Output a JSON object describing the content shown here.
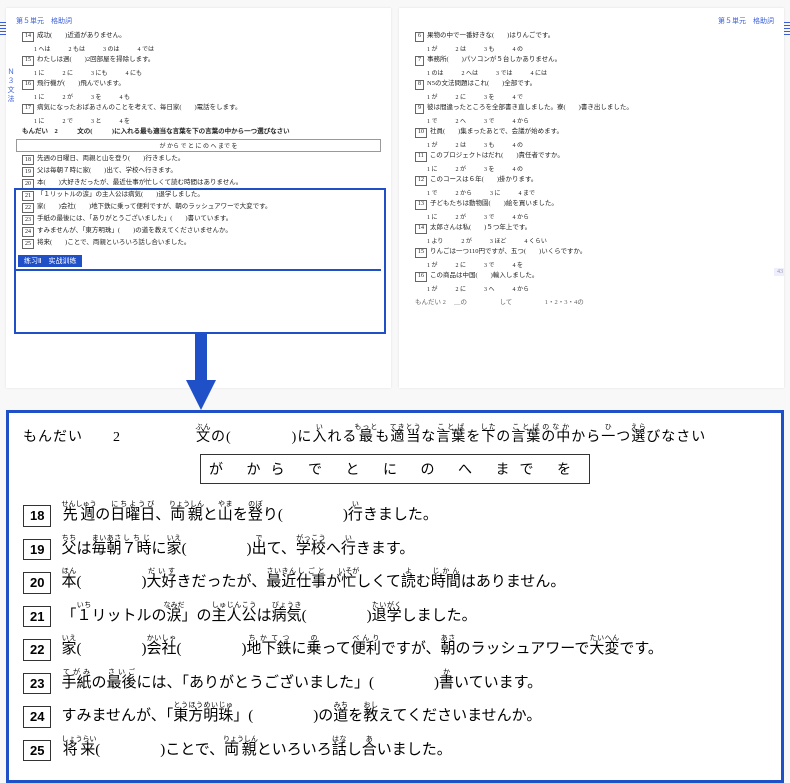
{
  "header": {
    "unit": "第５単元　格助詞",
    "sidelabel": "Ｎ３文法"
  },
  "leftPage": {
    "items": [
      {
        "n": "14",
        "text": "成功(　　)近道がありません。",
        "choices": [
          "1 へは",
          "2 もは",
          "3 のは",
          "4 では"
        ]
      },
      {
        "n": "15",
        "text": "わたしは週(　　)2回部屋を掃除します。",
        "choices": [
          "1 に",
          "2 に",
          "3 にも",
          "4 にも"
        ]
      },
      {
        "n": "16",
        "text": "飛行機が(　　)飛んでいます。",
        "choices": [
          "1 に",
          "2 が",
          "3 を",
          "4 も"
        ]
      },
      {
        "n": "17",
        "text": "病気になったおばあさんのことを考えて、毎日家(　　)電話をします。",
        "choices": [
          "1 に",
          "2 で",
          "3 と",
          "4 を"
        ]
      }
    ],
    "section2": {
      "head": "もんだい　2　　　文の(　　　)に入れる最も適当な言葉を下の言葉の中から一つ選びなさい",
      "options": "が から で と に の へ まで を",
      "items": [
        {
          "n": "18",
          "text": "先週の日曜日、両親と山を登り(　　)行きました。"
        },
        {
          "n": "19",
          "text": "父は毎朝７時に家(　　)出て、学校へ行きます。"
        },
        {
          "n": "20",
          "text": "本(　　)大好きだったが、最近仕事が忙しくて読む時間はありません。"
        },
        {
          "n": "21",
          "text": "「１リットルの涙」の主人公は病気(　　)退学しました。"
        },
        {
          "n": "22",
          "text": "家(　　)会社(　　)地下鉄に乗って便利ですが、朝のラッシュアワーで大変です。"
        },
        {
          "n": "23",
          "text": "手紙の最後には、「ありがとうございました」(　　)書いています。"
        },
        {
          "n": "24",
          "text": "すみませんが、「東方明珠」(　　)の道を教えてくださいませんか。"
        },
        {
          "n": "25",
          "text": "将来(　　)ことで、両親といろいろ話し合いました。"
        }
      ]
    },
    "practice": "练习Ⅱ　实战训练"
  },
  "rightPage": {
    "items": [
      {
        "n": "6",
        "text": "果物の中で一番好きな(　　)はりんごです。",
        "choices": [
          "1 が",
          "2 は",
          "3 も",
          "4 の"
        ]
      },
      {
        "n": "7",
        "text": "事務所(　　)パソコンが５台しかありません。",
        "choices": [
          "1 のは",
          "2 へは",
          "3 では",
          "4 には"
        ]
      },
      {
        "n": "8",
        "text": "N5の文法問題はこれ(　　)全部です。",
        "choices": [
          "1 が",
          "2 に",
          "3 を",
          "4 で"
        ]
      },
      {
        "n": "9",
        "text": "彼は間違ったところを全部書き直しました。寮(　　)書き出しました。",
        "choices": [
          "1 で",
          "2 へ",
          "3 で",
          "4 から"
        ]
      },
      {
        "n": "10",
        "text": "社員(　　)集まったあとで、会議が始めます。",
        "choices": [
          "1 が",
          "2 は",
          "3 も",
          "4 の"
        ]
      },
      {
        "n": "11",
        "text": "このプロジェクトはだれ(　　)責任者ですか。",
        "choices": [
          "1 に",
          "2 が",
          "3 を",
          "4 の"
        ]
      },
      {
        "n": "12",
        "text": "このコースは６年(　　)掛かります。",
        "choices": [
          "1 で",
          "2 から",
          "3 に",
          "4 まで"
        ]
      },
      {
        "n": "13",
        "text": "子どもたちは動物園(　　)絵を買いました。",
        "choices": [
          "1 に",
          "2 が",
          "3 で",
          "4 から"
        ]
      },
      {
        "n": "14",
        "text": "太郎さんは私(　　)５つ年上です。",
        "choices": [
          "1 より",
          "2 が",
          "3 ほど",
          "4 くらい"
        ]
      },
      {
        "n": "15",
        "text": "りんごは一つ110円ですが、五つ(　　)いくらですか。",
        "choices": [
          "1 が",
          "2 に",
          "3 で",
          "4 を"
        ]
      },
      {
        "n": "16",
        "text": "この商品は中国(　　)輸入しました。",
        "choices": [
          "1 が",
          "2 に",
          "3 へ",
          "4 から"
        ]
      }
    ],
    "footer": "もんだい 2 　＿の　　　　　して　　　　　1・2・3・4の"
  },
  "zoom": {
    "head_pre": "もんだい　　2",
    "head_main": "文の(　　　　)に入れる最も適当な言葉を下の言葉の中から一つ選びなさい",
    "ruby": {
      "bun": "ぶん",
      "i": "い",
      "motto": "もっと",
      "tekitou": "てきとう",
      "kotoba": "ことば",
      "shita": "した",
      "kotobanaka": "ことばのなか",
      "hi": "ひ",
      "era": "えら"
    },
    "options": "が から で と に の へ まで を",
    "items": [
      {
        "n": "18",
        "html": "<ruby>先週<rt>せんしゅう</rt></ruby>の<ruby>日曜日<rt>にちようび</rt></ruby>、<ruby>両親<rt>りょうしん</rt></ruby>と<ruby>山<rt>やま</rt></ruby>を<ruby>登<rt>のぼ</rt></ruby>り(　　　　)<ruby>行<rt>い</rt></ruby>きました。"
      },
      {
        "n": "19",
        "html": "<ruby>父<rt>ちち</rt></ruby>は<ruby>毎朝<rt>まいあさ</rt></ruby><ruby>７時<rt>しちじ</rt></ruby>に<ruby>家<rt>いえ</rt></ruby>(　　　　)<ruby>出<rt>で</rt></ruby>て、<ruby>学校<rt>がっこう</rt></ruby>へ<ruby>行<rt>い</rt></ruby>きます。"
      },
      {
        "n": "20",
        "html": "<ruby>本<rt>ほん</rt></ruby>(　　　　)<ruby>大好<rt>だいす</rt></ruby>きだったが、<ruby>最近<rt>さいきん</rt></ruby><ruby>仕事<rt>しごと</rt></ruby>が<ruby>忙<rt>いそが</rt></ruby>しくて<ruby>読<rt>よ</rt></ruby>む<ruby>時間<rt>じかん</rt></ruby>はありません。"
      },
      {
        "n": "21",
        "html": "「<ruby>１<rt>いち</rt></ruby>リットルの<ruby>涙<rt>なみだ</rt></ruby>」の<ruby>主人公<rt>しゅじんこう</rt></ruby>は<ruby>病気<rt>びょうき</rt></ruby>(　　　　)<ruby>退学<rt>たいがく</rt></ruby>しました。"
      },
      {
        "n": "22",
        "html": "<ruby>家<rt>いえ</rt></ruby>(　　　　)<ruby>会社<rt>かいしゃ</rt></ruby>(　　　　)<ruby>地下鉄<rt>ちかてつ</rt></ruby>に<ruby>乗<rt>の</rt></ruby>って<ruby>便利<rt>べんり</rt></ruby>ですが、<ruby>朝<rt>あさ</rt></ruby>のラッシュアワーで<ruby>大変<rt>たいへん</rt></ruby>です。"
      },
      {
        "n": "23",
        "html": "<ruby>手紙<rt>てがみ</rt></ruby>の<ruby>最後<rt>さいご</rt></ruby>には、「ありがとうございました」(　　　　)<ruby>書<rt>か</rt></ruby>いています。"
      },
      {
        "n": "24",
        "html": "すみませんが、「<ruby>東方明珠<rt>とうほうめいじゅ</rt></ruby>」(　　　　)の<ruby>道<rt>みち</rt></ruby>を<ruby>教<rt>おし</rt></ruby>えてくださいませんか。"
      },
      {
        "n": "25",
        "html": "<ruby>将来<rt>しょうらい</rt></ruby>(　　　　)ことで、<ruby>両親<rt>りょうしん</rt></ruby>といろいろ<ruby>話<rt>はな</rt></ruby>し<ruby>合<rt>あ</rt></ruby>いました。"
      }
    ]
  },
  "pagenum": "43"
}
